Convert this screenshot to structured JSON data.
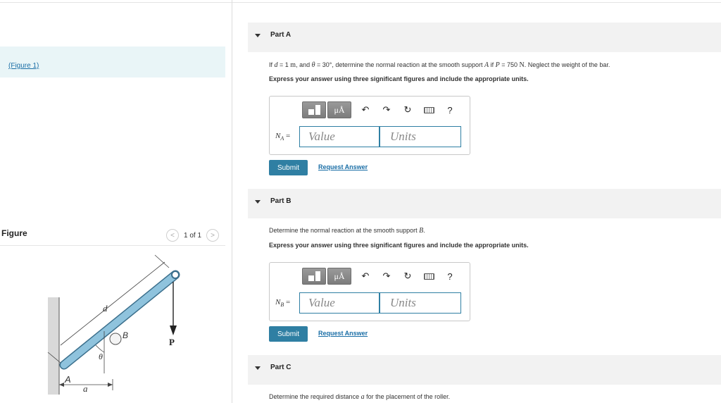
{
  "left": {
    "figure_link": "(Figure 1)",
    "figure_heading": "Figure",
    "pager": {
      "prev": "<",
      "text": "1 of 1",
      "next": ">"
    },
    "figure_labels": {
      "d": "d",
      "B": "B",
      "P": "P",
      "theta": "θ",
      "A": "A",
      "a": "a"
    }
  },
  "parts": [
    {
      "title": "Part A",
      "prompt": {
        "pre": "If ",
        "d": "d",
        "eq1": " = 1 ",
        "m": "m",
        "and": ", and ",
        "theta": "θ",
        "eq2": " = 30°",
        "mid": ", determine the normal reaction at the smooth support ",
        "A": "A",
        "if": " if ",
        "P": "P",
        "eq3": " = 750 ",
        "N": "N",
        "post": ". Neglect the weight of the bar."
      },
      "instruction": "Express your answer using three significant figures and include the appropriate units.",
      "answer": {
        "var": "N",
        "sub": "A",
        "eq": " =",
        "value_placeholder": "Value",
        "units_placeholder": "Units"
      },
      "submit": "Submit",
      "request": "Request Answer"
    },
    {
      "title": "Part B",
      "prompt": {
        "pre": "Determine the normal reaction at the smooth support ",
        "B": "B",
        "post": "."
      },
      "instruction": "Express your answer using three significant figures and include the appropriate units.",
      "answer": {
        "var": "N",
        "sub": "B",
        "eq": " =",
        "value_placeholder": "Value",
        "units_placeholder": "Units"
      },
      "submit": "Submit",
      "request": "Request Answer"
    },
    {
      "title": "Part C",
      "prompt": {
        "pre": "Determine the required distance ",
        "a": "a",
        "post": " for the placement of the roller."
      }
    }
  ],
  "toolbar": {
    "mu": "μÅ",
    "help": "?"
  },
  "colors": {
    "accent": "#2f7fa3",
    "link": "#1a6ea6",
    "header_bg": "#f2f2f2",
    "figure_bar": "#e9f5f7",
    "bar": "#8fc3dd"
  }
}
